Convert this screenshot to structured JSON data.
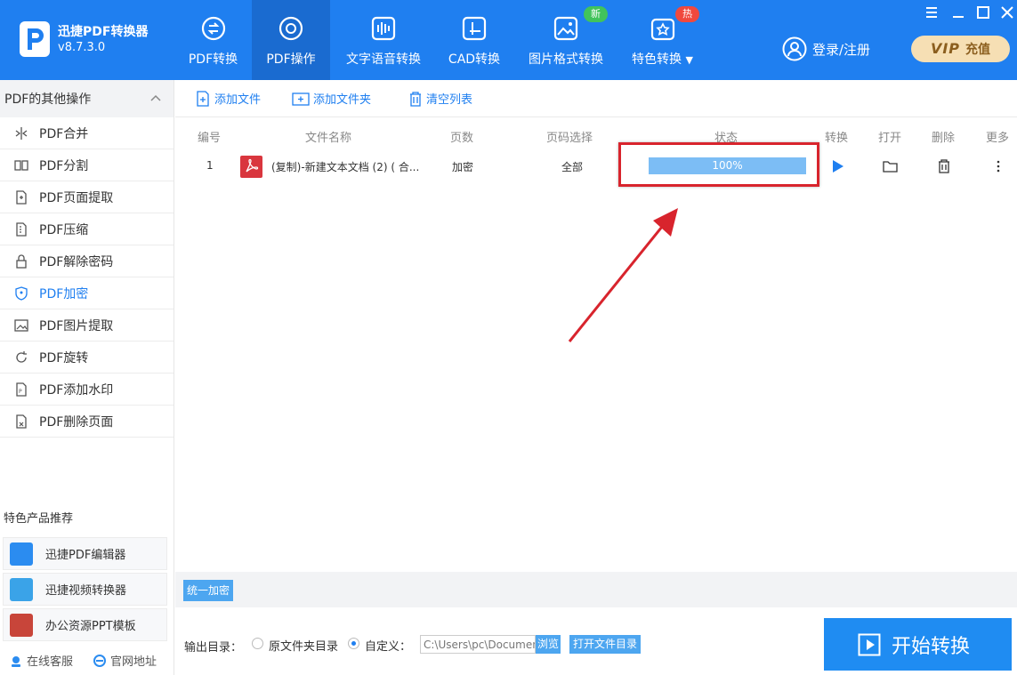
{
  "app": {
    "name": "迅捷PDF转换器",
    "version": "v8.7.3.0"
  },
  "nav": [
    {
      "label": "PDF转换",
      "icon": "pdf-convert-icon"
    },
    {
      "label": "PDF操作",
      "icon": "pdf-operate-icon",
      "active": true
    },
    {
      "label": "文字语音转换",
      "icon": "audio-icon"
    },
    {
      "label": "CAD转换",
      "icon": "cad-icon"
    },
    {
      "label": "图片格式转换",
      "icon": "image-icon",
      "badge": "新"
    },
    {
      "label": "特色转换",
      "icon": "special-icon",
      "badge": "热"
    }
  ],
  "header": {
    "login": "登录/注册",
    "vip_mark": "VIP",
    "vip_label": "充值"
  },
  "sidebar": {
    "title": "PDF的其他操作",
    "items": [
      {
        "label": "PDF合并"
      },
      {
        "label": "PDF分割"
      },
      {
        "label": "PDF页面提取"
      },
      {
        "label": "PDF压缩"
      },
      {
        "label": "PDF解除密码"
      },
      {
        "label": "PDF加密",
        "active": true
      },
      {
        "label": "PDF图片提取"
      },
      {
        "label": "PDF旋转"
      },
      {
        "label": "PDF添加水印"
      },
      {
        "label": "PDF删除页面"
      }
    ],
    "promo_title": "特色产品推荐",
    "promos": [
      {
        "label": "迅捷PDF编辑器"
      },
      {
        "label": "迅捷视频转换器"
      },
      {
        "label": "办公资源PPT模板"
      }
    ],
    "footer": {
      "service": "在线客服",
      "website": "官网地址"
    }
  },
  "toolbar": {
    "add_file": "添加文件",
    "add_folder": "添加文件夹",
    "clear_list": "清空列表"
  },
  "table": {
    "headers": {
      "index": "编号",
      "filename": "文件名称",
      "pages": "页数",
      "page_select": "页码选择",
      "status": "状态",
      "convert": "转换",
      "open": "打开",
      "delete": "删除",
      "more": "更多"
    },
    "rows": [
      {
        "index": "1",
        "filename": "(复制)-新建文本文档 (2) ( 合...",
        "pages": "加密",
        "page_select": "全部",
        "progress_text": "100%",
        "progress": 1.0
      }
    ]
  },
  "bottom": {
    "unify_button": "统一加密",
    "output_label": "输出目录：",
    "option_original": "原文件夹目录",
    "option_custom": "自定义：",
    "path_value": "C:\\Users\\pc\\Documen",
    "browse": "浏览",
    "open_folder": "打开文件目录",
    "start": "开始转换"
  },
  "colors": {
    "primary": "#1f7ff0",
    "highlight": "#d8242d",
    "progress": "#7cbdf5"
  }
}
